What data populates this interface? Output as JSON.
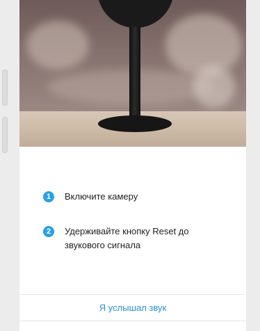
{
  "product_image": {
    "alt": "camera-on-stand"
  },
  "steps": [
    {
      "number": "1",
      "text": "Включите камеру"
    },
    {
      "number": "2",
      "text": "Удерживайте кнопку Reset до звукового сигнала"
    }
  ],
  "actions": {
    "heard_sound_label": "Я услышал звук"
  },
  "colors": {
    "accent": "#2aa0e6",
    "link": "#2a8fd6"
  }
}
